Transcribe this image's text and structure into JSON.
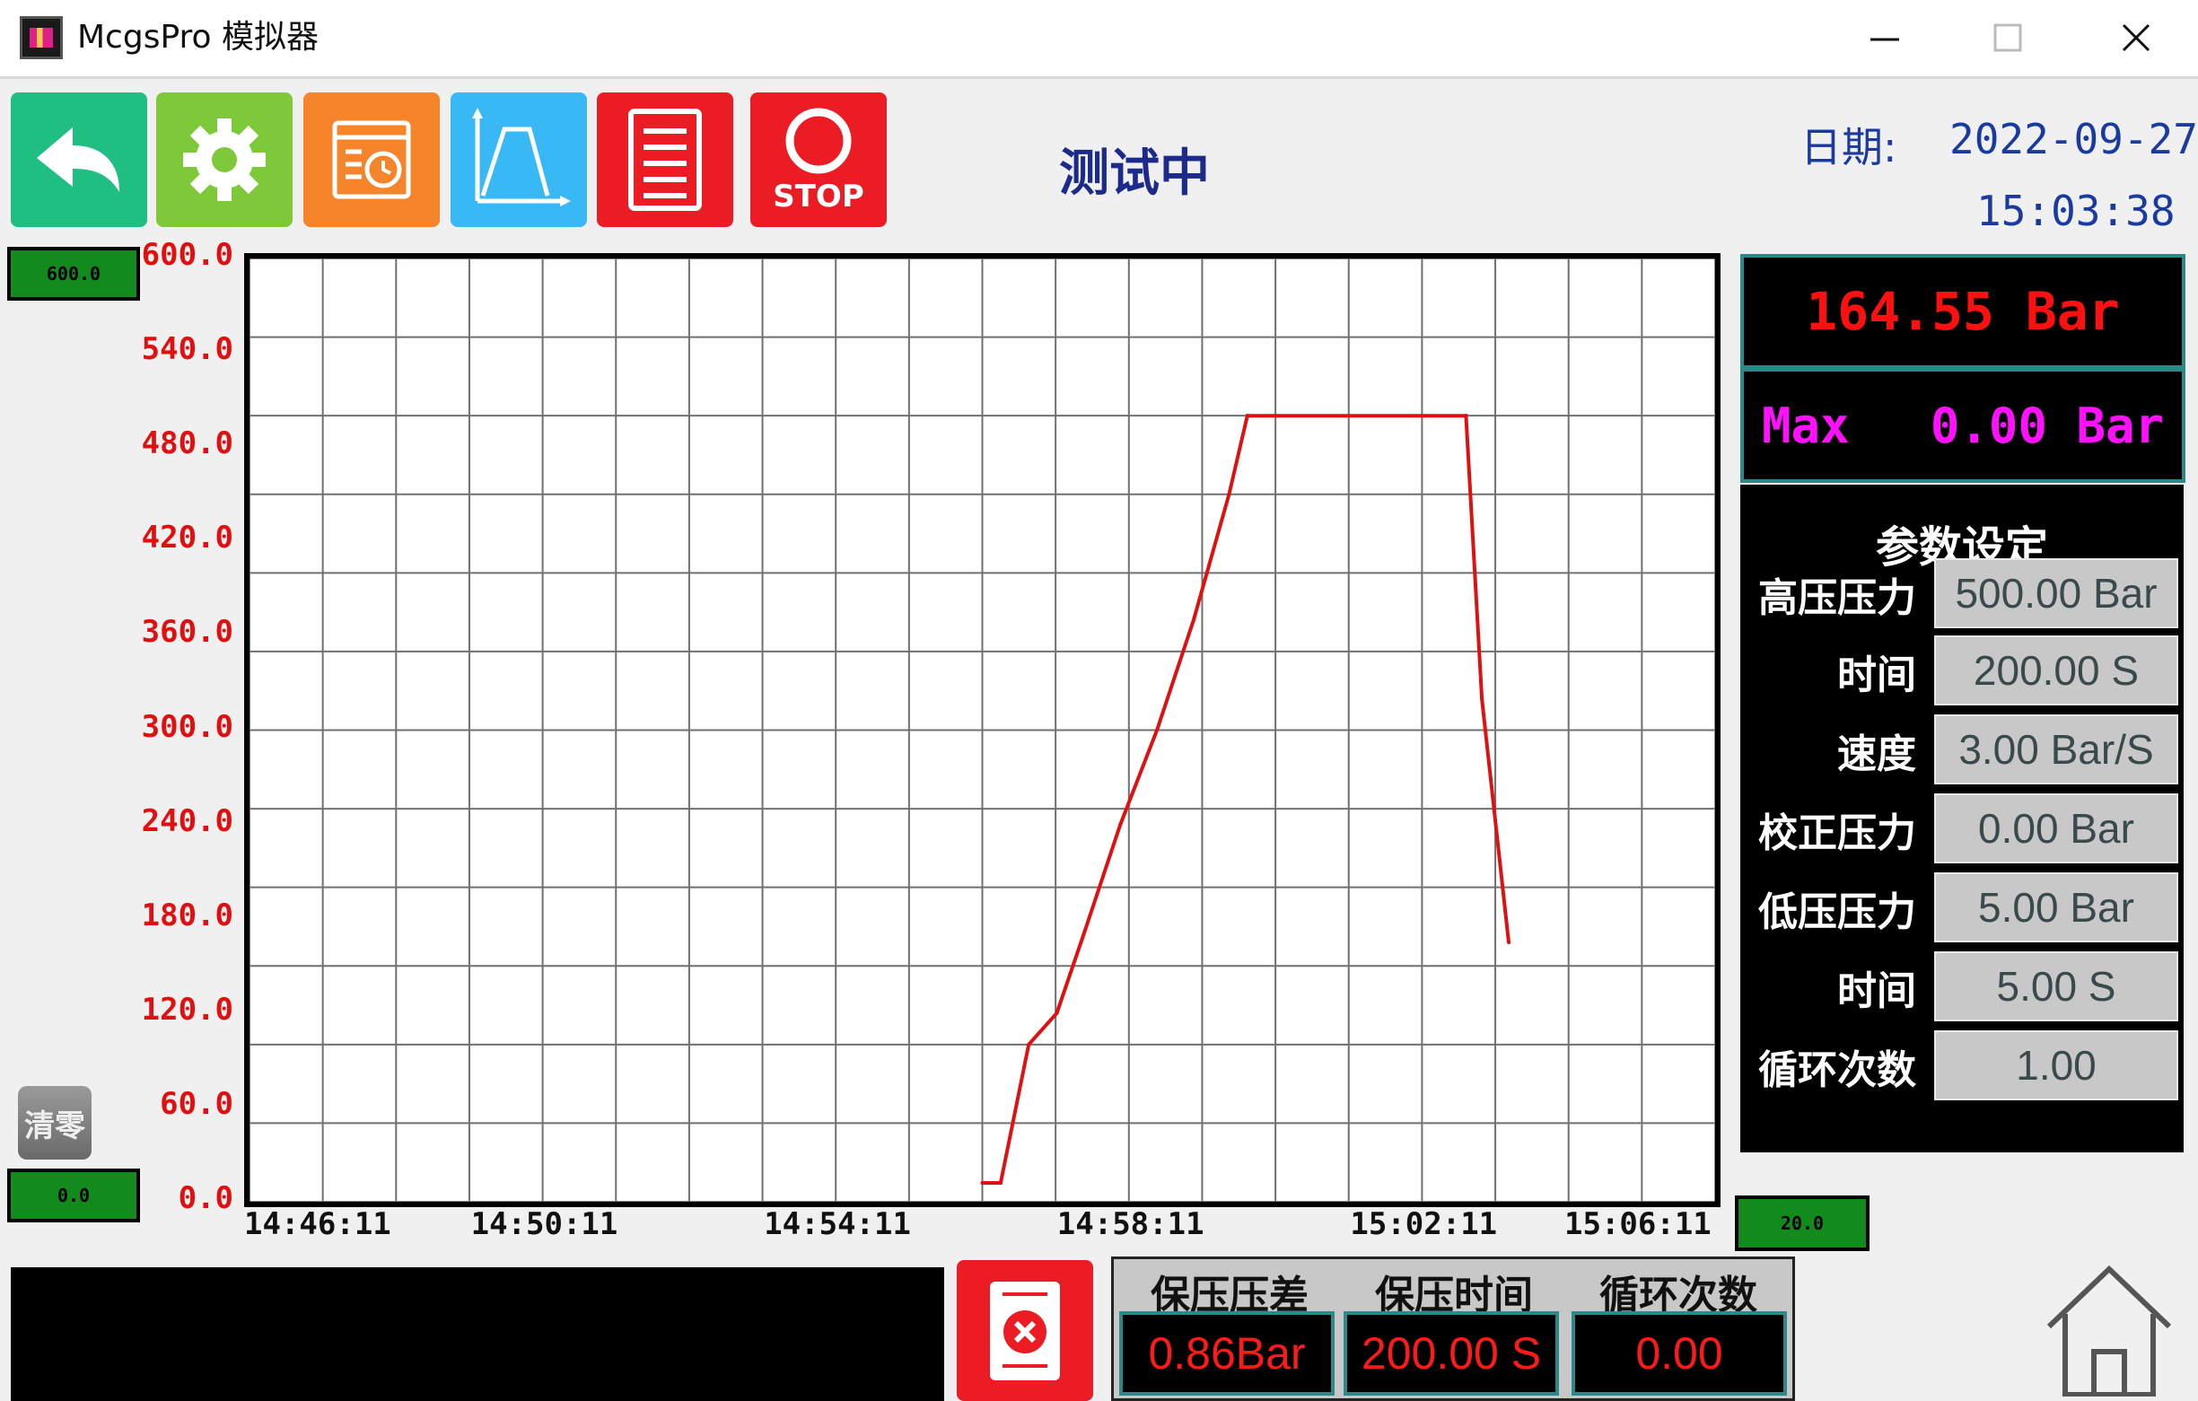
{
  "window": {
    "title": "McgsPro 模拟器"
  },
  "header": {
    "status": "测试中",
    "date_label": "日期:",
    "date": "2022-09-27",
    "time": "15:03:38"
  },
  "toolbar": {
    "stop_label": "STOP"
  },
  "chart_controls": {
    "y_max_box": "600.0",
    "y_min_box": "0.0",
    "x_span_box": "20.0",
    "clear_label": "清零"
  },
  "chart_data": {
    "type": "line",
    "title": "",
    "xlabel": "",
    "ylabel": "",
    "ylim": [
      0,
      600
    ],
    "xlim": [
      "14:46:11",
      "15:06:11"
    ],
    "x_tick_labels": [
      "14:46:11",
      "14:50:11",
      "14:54:11",
      "14:58:11",
      "15:02:11",
      "15:06:11"
    ],
    "y_tick_labels": [
      "600.0",
      "540.0",
      "480.0",
      "420.0",
      "360.0",
      "300.0",
      "240.0",
      "180.0",
      "120.0",
      "60.0",
      "0.0"
    ],
    "grid": true,
    "series": [
      {
        "color": "#e01010",
        "x": [
          "14:56:11",
          "14:56:26",
          "14:56:49",
          "14:57:12",
          "14:57:34",
          "14:58:04",
          "14:58:34",
          "14:59:04",
          "14:59:33",
          "14:59:48",
          "15:02:47",
          "15:03:00",
          "15:03:22"
        ],
        "y": [
          12,
          12,
          100,
          120,
          170,
          240,
          300,
          370,
          450,
          500,
          500,
          320,
          165
        ]
      }
    ]
  },
  "readouts": {
    "pressure": "164.55 Bar",
    "max_label": "Max",
    "max_value": "0.00 Bar"
  },
  "params": {
    "title": "参数设定",
    "rows": [
      {
        "label": "高压压力",
        "value": "500.00 Bar"
      },
      {
        "label": "时间",
        "value": "200.00 S"
      },
      {
        "label": "速度",
        "value": "3.00 Bar/S"
      },
      {
        "label": "校正压力",
        "value": "0.00 Bar"
      },
      {
        "label": "低压压力",
        "value": "5.00 Bar"
      },
      {
        "label": "时间",
        "value": "5.00 S"
      },
      {
        "label": "循环次数",
        "value": "1.00"
      }
    ]
  },
  "hold": {
    "headers": [
      "保压压差",
      "保压时间",
      "循环次数"
    ],
    "values": [
      "0.86Bar",
      "200.00 S",
      "0.00"
    ]
  },
  "colors": {
    "back": "#1fbf84",
    "settings": "#7dc93a",
    "record": "#f5842a",
    "curve": "#38b9f5",
    "red": "#ec1c24",
    "status_blue": "#1c2a8a"
  }
}
